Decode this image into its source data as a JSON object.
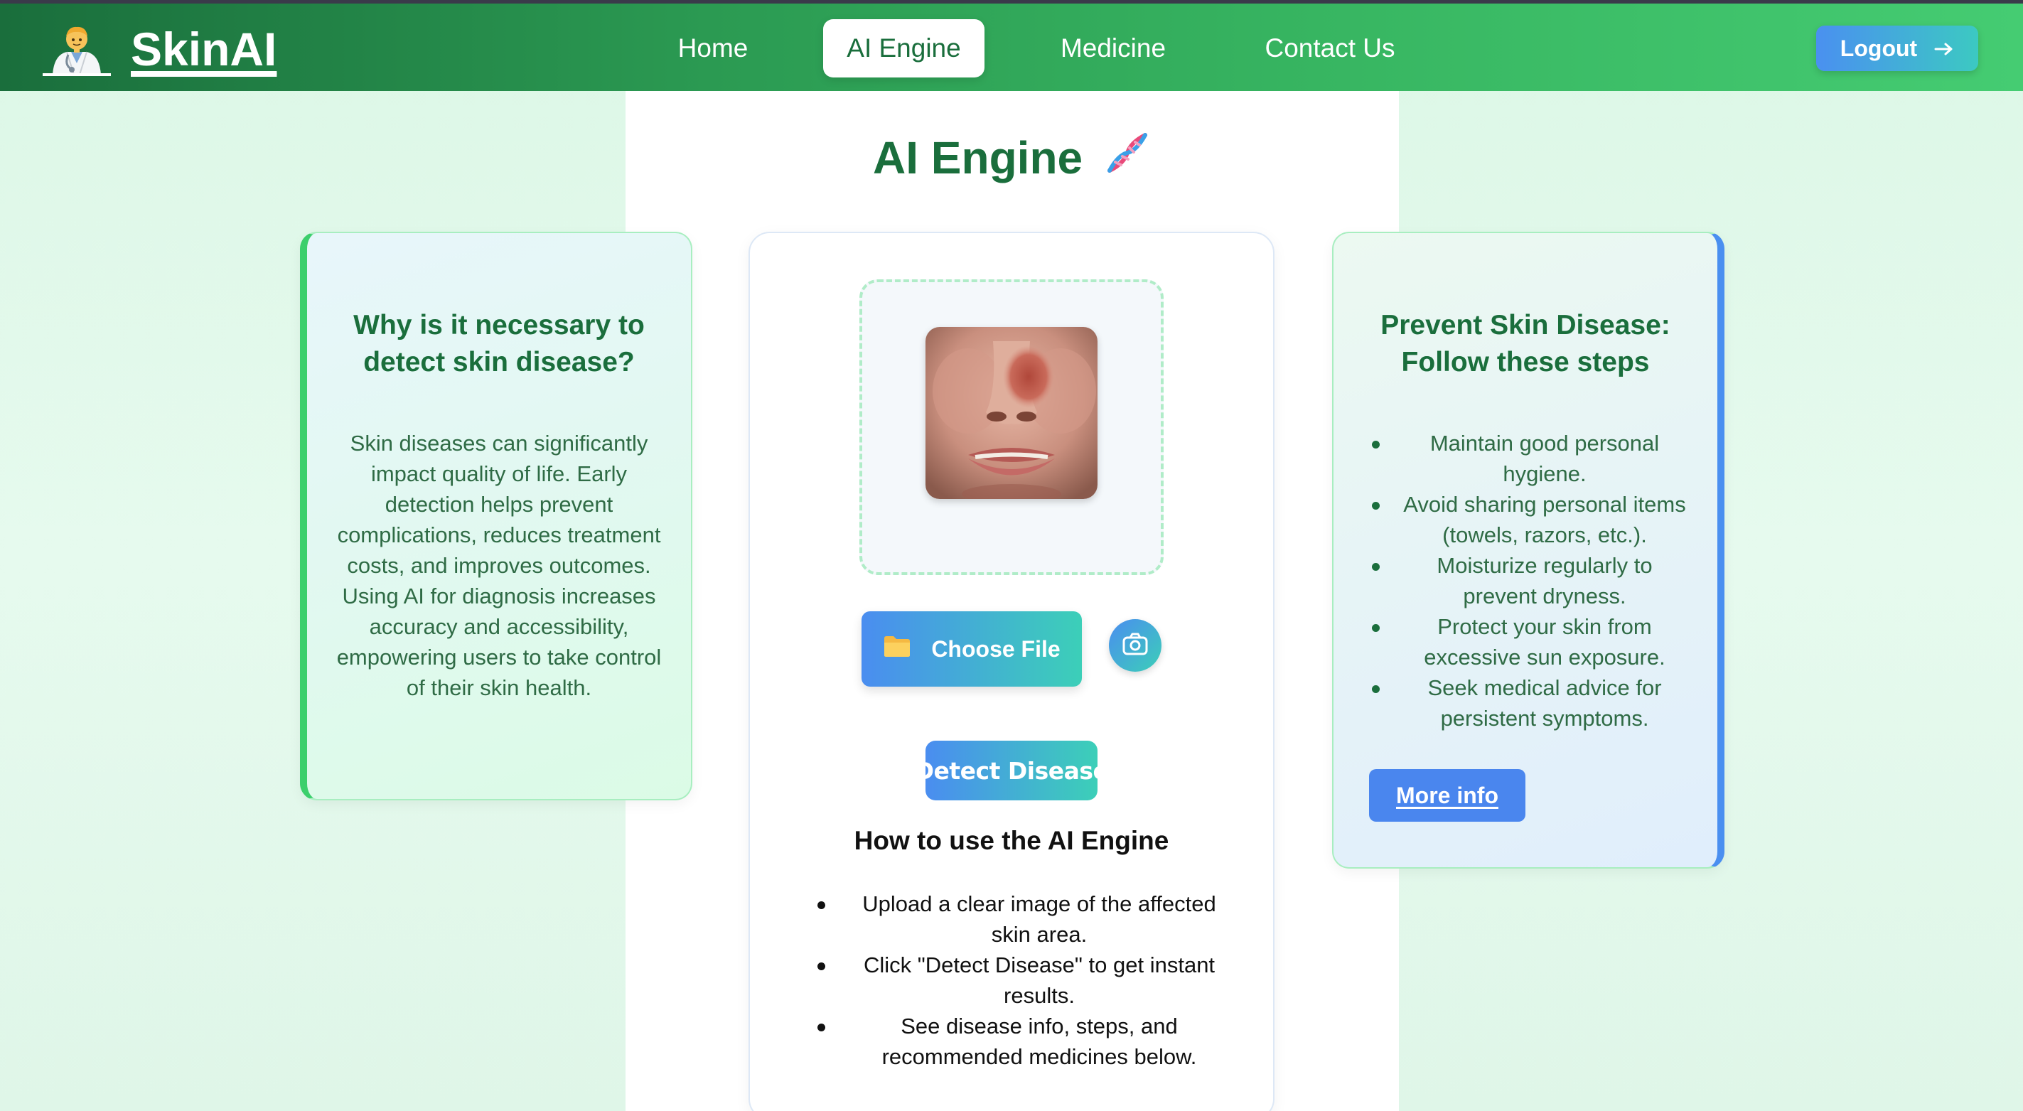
{
  "brand": {
    "name": "SkinAI",
    "icon": "doctor-icon"
  },
  "nav": {
    "links": [
      {
        "label": "Home",
        "active": false
      },
      {
        "label": "AI Engine",
        "active": true
      },
      {
        "label": "Medicine",
        "active": false
      },
      {
        "label": "Contact Us",
        "active": false
      }
    ],
    "logout_label": "Logout",
    "logout_icon": "arrow-right-icon"
  },
  "page": {
    "title": "AI Engine",
    "title_icon": "dna-icon"
  },
  "left_card": {
    "heading": "Why is it necessary to detect skin disease?",
    "body": "Skin diseases can significantly impact quality of life. Early detection helps prevent complications, reduces treatment costs, and improves outcomes. Using AI for diagnosis increases accuracy and accessibility, empowering users to take control of their skin health."
  },
  "upload": {
    "choose_label": "Choose File",
    "choose_icon": "folder-icon",
    "camera_icon": "camera-icon",
    "detect_label": "Detect Disease"
  },
  "howto": {
    "title": "How to use the AI Engine",
    "steps": [
      "Upload a clear image of the affected skin area.",
      "Click \"Detect Disease\" to get instant results.",
      "See disease info, steps, and recommended medicines below."
    ]
  },
  "right_card": {
    "heading": "Prevent Skin Disease: Follow these steps",
    "steps": [
      "Maintain good personal hygiene.",
      "Avoid sharing personal items (towels, razors, etc.).",
      "Moisturize regularly to prevent dryness.",
      "Protect your skin from excessive sun exposure.",
      "Seek medical advice for persistent symptoms."
    ],
    "more_info_label": "More info"
  },
  "colors": {
    "brand_green": "#1a6e3c",
    "accent_blue": "#4a8df0",
    "accent_teal": "#3ccfb8",
    "left_border": "#3ccf6c",
    "right_border": "#4a8ff0"
  }
}
